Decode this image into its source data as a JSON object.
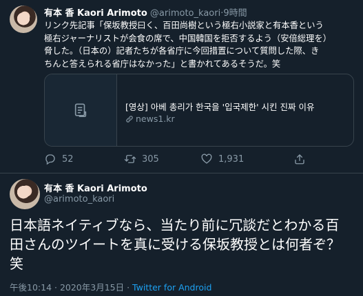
{
  "tweet1": {
    "display_name": "有本 香 Kaori Arimoto",
    "handle": "@arimoto_kaori",
    "separator": "·",
    "time": "9時間",
    "lines": [
      "リンク先記事「保坂教授曰く、百田尚樹という極右小説家と有本香という",
      "極右ジャーナリストが会食の席で、中国韓国を拒否するよう（安倍総理を）",
      "脅した。（日本の）記者たちが各省庁に今回措置について質問した際、き",
      "ちんと答えられる省庁はなかった」と書かれてあるそうだ。笑"
    ],
    "card": {
      "title": "[영상] 아베 총리가 한국을 '입국제한' 시킨 진짜 이유",
      "domain": "news1.kr"
    },
    "actions": {
      "replies": "52",
      "retweets": "305",
      "likes": "1,931"
    }
  },
  "tweet2": {
    "display_name": "有本 香 Kaori Arimoto",
    "handle": "@arimoto_kaori",
    "lines": [
      "日本語ネイティブなら、当たり前に冗談だとわかる百",
      "田さんのツイートを真に受ける保坂教授とは何者ぞ？",
      "笑"
    ],
    "timestamp": "午後10:14 · 2020年3月15日 · ",
    "source": "Twitter for Android"
  },
  "colors": {
    "background": "#15202b",
    "border": "#38444d",
    "secondary_text": "#8899a6",
    "link": "#1da1f2"
  },
  "icons": [
    "reply-icon",
    "retweet-icon",
    "like-icon",
    "share-icon",
    "link-icon",
    "document-icon"
  ]
}
